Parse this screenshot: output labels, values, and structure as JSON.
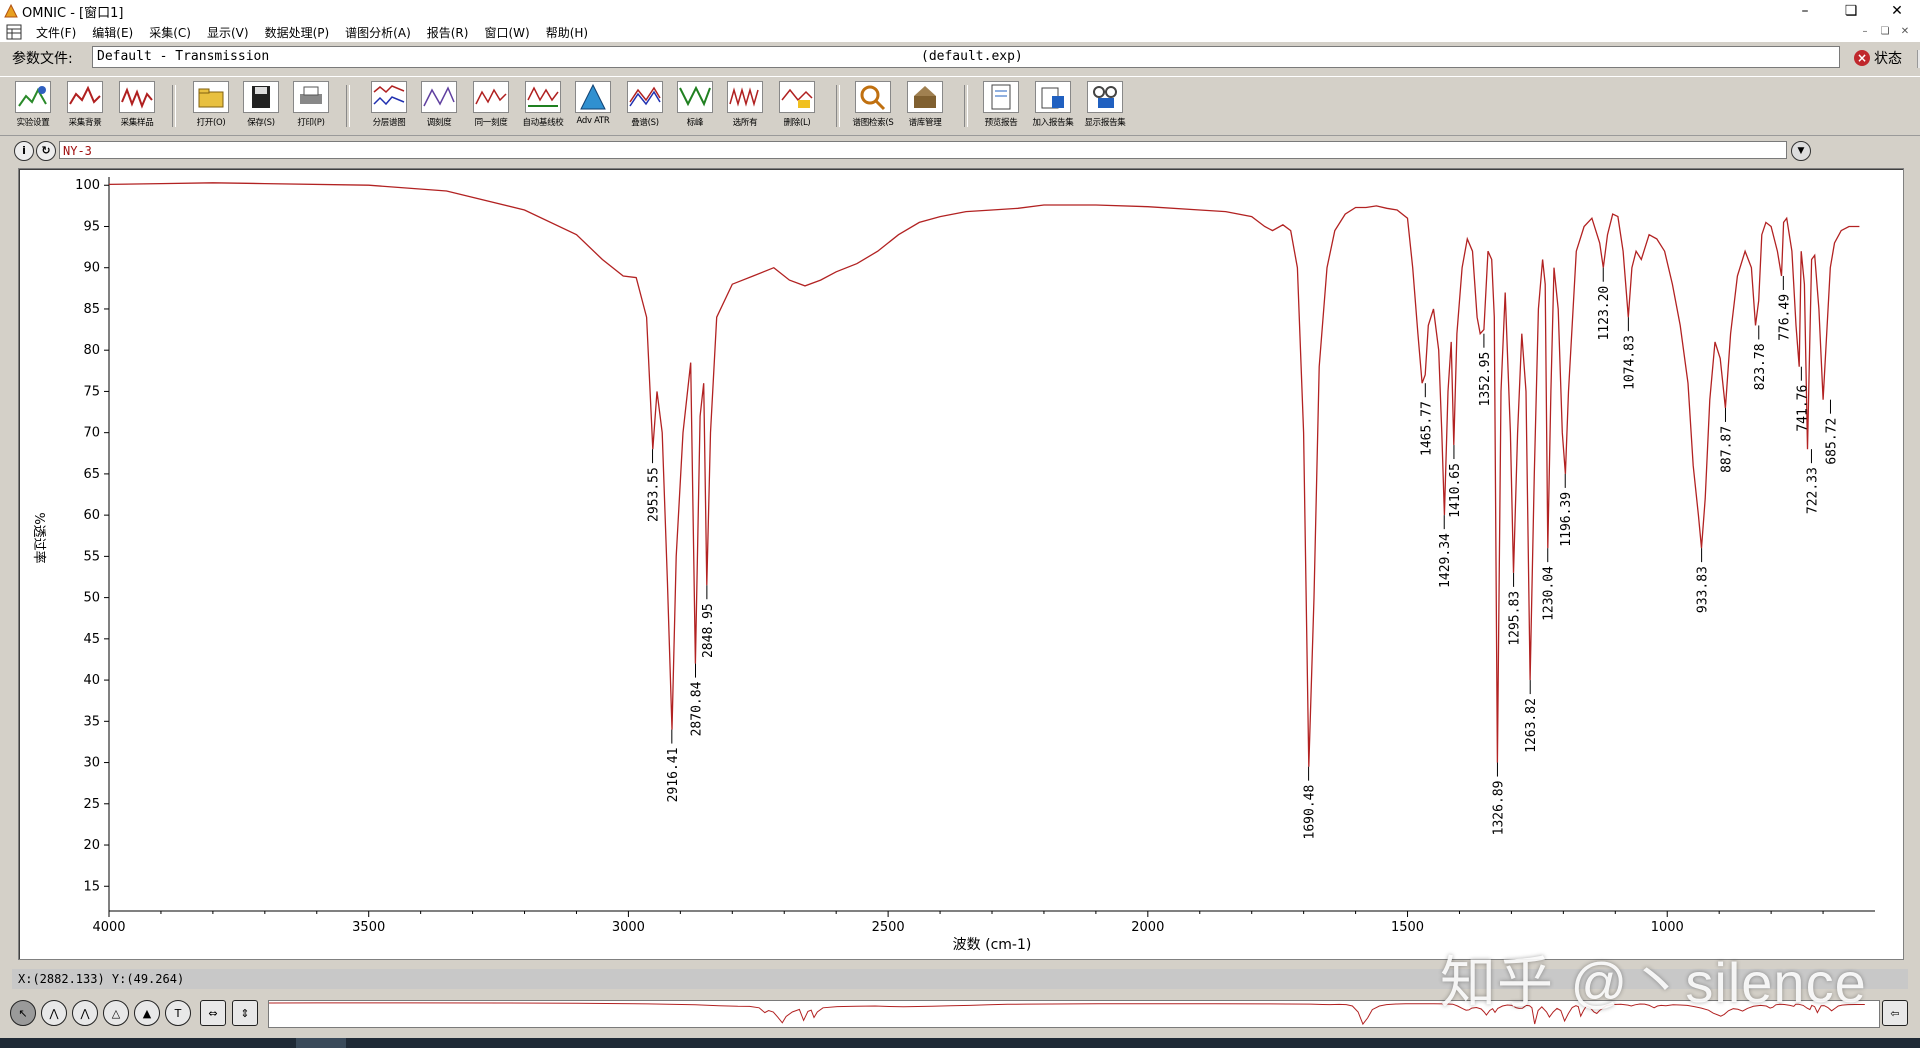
{
  "window": {
    "title": "OMNIC - [窗口1]"
  },
  "menu": [
    "文件(F)",
    "编辑(E)",
    "采集(C)",
    "显示(V)",
    "数据处理(P)",
    "谱图分析(A)",
    "报告(R)",
    "窗口(W)",
    "帮助(H)"
  ],
  "param": {
    "label": "参数文件:",
    "value": "Default - Transmission",
    "exp": "(default.exp)",
    "status": "状态"
  },
  "toolbar": [
    "实验设置",
    "采集背景",
    "采集样品",
    "打开(O)",
    "保存(S)",
    "打印(P)",
    "分层谱图",
    "调刻度",
    "同一刻度",
    "自动基线校",
    "Adv ATR",
    "叠谱(S)",
    "标峰",
    "选所有",
    "删除(L)",
    "谱图检索(S",
    "谱库管理",
    "预览报告",
    "加入报告集",
    "显示报告集"
  ],
  "spectrum_title": "NY-3",
  "coord": "X:(2882.133) Y:(49.264)",
  "watermark": "知乎 @丶silence",
  "colors": {
    "spectrum": "#b22222",
    "background": "#d4d0c8"
  },
  "chart_data": {
    "type": "line",
    "xlabel": "波数 (cm-1)",
    "ylabel": "%透过率",
    "xlim": [
      4000,
      600
    ],
    "ylim": [
      12,
      101
    ],
    "xticks": [
      4000,
      3500,
      3000,
      2500,
      2000,
      1500,
      1000
    ],
    "yticks": [
      15,
      20,
      25,
      30,
      35,
      40,
      45,
      50,
      55,
      60,
      65,
      70,
      75,
      80,
      85,
      90,
      95,
      100
    ],
    "x": [
      4000,
      3900,
      3800,
      3700,
      3500,
      3350,
      3200,
      3100,
      3050,
      3010,
      2985,
      2965,
      2953,
      2945,
      2935,
      2925,
      2916,
      2908,
      2895,
      2880,
      2871,
      2862,
      2855,
      2849,
      2842,
      2830,
      2800,
      2760,
      2720,
      2690,
      2660,
      2630,
      2600,
      2560,
      2520,
      2480,
      2440,
      2400,
      2350,
      2300,
      2250,
      2200,
      2100,
      2000,
      1900,
      1850,
      1800,
      1775,
      1760,
      1740,
      1725,
      1712,
      1700,
      1690,
      1680,
      1670,
      1655,
      1640,
      1620,
      1600,
      1580,
      1560,
      1540,
      1520,
      1500,
      1490,
      1480,
      1472,
      1466,
      1460,
      1450,
      1440,
      1434,
      1429,
      1422,
      1416,
      1411,
      1405,
      1395,
      1385,
      1375,
      1366,
      1360,
      1353,
      1345,
      1338,
      1333,
      1327,
      1320,
      1312,
      1302,
      1296,
      1288,
      1280,
      1272,
      1264,
      1256,
      1248,
      1240,
      1235,
      1230,
      1224,
      1218,
      1210,
      1202,
      1196,
      1190,
      1175,
      1160,
      1145,
      1130,
      1123,
      1115,
      1105,
      1095,
      1085,
      1075,
      1068,
      1060,
      1050,
      1035,
      1020,
      1005,
      990,
      975,
      960,
      950,
      940,
      934,
      927,
      918,
      908,
      898,
      888,
      878,
      865,
      850,
      838,
      830,
      824,
      818,
      810,
      800,
      788,
      780,
      776,
      770,
      760,
      752,
      746,
      742,
      736,
      730,
      726,
      722,
      716,
      708,
      700,
      693,
      686,
      678,
      665,
      650,
      630,
      610,
      600
    ],
    "y": [
      100.1,
      100.2,
      100.3,
      100.2,
      100.0,
      99.3,
      97.0,
      94.0,
      91.0,
      89.0,
      88.8,
      84.0,
      68.0,
      75.0,
      70.0,
      52.0,
      34.0,
      55.0,
      70.0,
      78.5,
      42.0,
      72.0,
      76.0,
      51.5,
      70.0,
      84.0,
      88.0,
      89.0,
      90.0,
      88.5,
      87.8,
      88.5,
      89.5,
      90.5,
      92.0,
      94.0,
      95.5,
      96.2,
      96.8,
      97.0,
      97.2,
      97.6,
      97.6,
      97.4,
      97.0,
      96.8,
      96.2,
      95.0,
      94.5,
      95.2,
      94.5,
      90.0,
      70.0,
      29.5,
      50.0,
      78.0,
      90.0,
      94.5,
      96.5,
      97.3,
      97.3,
      97.5,
      97.2,
      97.0,
      96.0,
      90.0,
      82.0,
      76.0,
      77.0,
      83.0,
      85.0,
      80.0,
      70.0,
      60.0,
      75.0,
      81.0,
      68.5,
      82.0,
      90.0,
      93.5,
      92.0,
      84.0,
      82.0,
      82.5,
      92.0,
      91.0,
      84.0,
      30.0,
      75.0,
      87.0,
      70.0,
      53.0,
      70.0,
      82.0,
      75.0,
      40.0,
      65.0,
      85.0,
      91.0,
      88.0,
      56.0,
      75.0,
      90.0,
      85.0,
      70.0,
      65.0,
      75.0,
      92.0,
      95.0,
      96.0,
      93.0,
      90.0,
      94.0,
      96.5,
      96.2,
      92.0,
      84.0,
      90.0,
      92.0,
      91.0,
      94.0,
      93.5,
      92.0,
      88.0,
      83.0,
      76.0,
      66.0,
      60.0,
      56.0,
      62.0,
      74.0,
      81.0,
      79.0,
      73.0,
      82.0,
      89.0,
      92.0,
      90.0,
      83.0,
      86.0,
      94.0,
      95.5,
      95.0,
      92.0,
      89.0,
      95.5,
      96.0,
      92.0,
      83.0,
      78.0,
      92.0,
      88.0,
      68.0,
      80.0,
      91.0,
      91.5,
      85.0,
      74.0,
      82.0,
      90.0,
      93.0,
      94.5,
      95.0,
      95.0
    ],
    "peak_labels": [
      {
        "x": 2953.55,
        "y": 68.0,
        "label": "2953.55"
      },
      {
        "x": 2916.41,
        "y": 34.0,
        "label": "2916.41"
      },
      {
        "x": 2870.84,
        "y": 42.0,
        "label": "2870.84"
      },
      {
        "x": 2848.95,
        "y": 51.5,
        "label": "2848.95"
      },
      {
        "x": 1690.48,
        "y": 29.5,
        "label": "1690.48"
      },
      {
        "x": 1465.77,
        "y": 76.0,
        "label": "1465.77"
      },
      {
        "x": 1429.34,
        "y": 60.0,
        "label": "1429.34"
      },
      {
        "x": 1410.65,
        "y": 68.5,
        "label": "1410.65"
      },
      {
        "x": 1352.95,
        "y": 82.0,
        "label": "1352.95"
      },
      {
        "x": 1326.89,
        "y": 30.0,
        "label": "1326.89"
      },
      {
        "x": 1295.83,
        "y": 53.0,
        "label": "1295.83"
      },
      {
        "x": 1263.82,
        "y": 40.0,
        "label": "1263.82"
      },
      {
        "x": 1230.04,
        "y": 56.0,
        "label": "1230.04"
      },
      {
        "x": 1196.39,
        "y": 65.0,
        "label": "1196.39"
      },
      {
        "x": 1123.2,
        "y": 90.0,
        "label": "1123.20"
      },
      {
        "x": 1074.83,
        "y": 84.0,
        "label": "1074.83"
      },
      {
        "x": 933.83,
        "y": 56.0,
        "label": "933.83"
      },
      {
        "x": 887.87,
        "y": 73.0,
        "label": "887.87"
      },
      {
        "x": 823.78,
        "y": 83.0,
        "label": "823.78"
      },
      {
        "x": 776.49,
        "y": 89.0,
        "label": "776.49"
      },
      {
        "x": 741.76,
        "y": 78.0,
        "label": "741.76"
      },
      {
        "x": 722.33,
        "y": 68.0,
        "label": "722.33"
      },
      {
        "x": 685.72,
        "y": 74.0,
        "label": "685.72"
      }
    ]
  }
}
